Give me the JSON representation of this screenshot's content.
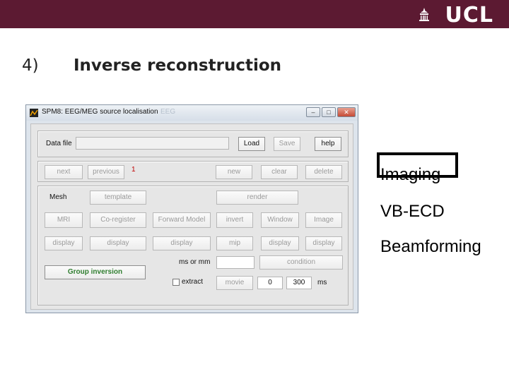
{
  "slide": {
    "logo_text": "UCL",
    "number": "4)",
    "title": "Inverse reconstruction"
  },
  "window": {
    "title": "SPM8: EEG/MEG source localisation",
    "ghost_title": "EEG",
    "buttons": {
      "minimize": "–",
      "maximize": "□",
      "close": "✕"
    }
  },
  "row1": {
    "data_file_label": "Data file",
    "data_file_value": "",
    "load": "Load",
    "save": "Save",
    "help": "help"
  },
  "row2": {
    "next": "next",
    "previous": "previous",
    "index": "1",
    "new": "new",
    "clear": "clear",
    "delete": "delete"
  },
  "row3": {
    "mesh": "Mesh",
    "template": "template",
    "render": "render"
  },
  "row4": {
    "mri": "MRI",
    "coregister": "Co-register",
    "forward_model": "Forward Model",
    "invert": "invert",
    "window": "Window",
    "image": "Image"
  },
  "row5": {
    "display": [
      "display",
      "display",
      "display",
      "mip",
      "display",
      "display"
    ]
  },
  "row6": {
    "units_label": "ms or mm",
    "units_value": "",
    "condition": "condition"
  },
  "row7": {
    "group_inversion": "Group inversion",
    "extract": "extract",
    "movie": "movie",
    "start": "0",
    "end": "300",
    "ms": "ms"
  },
  "methods": [
    "Imaging",
    "VB-ECD",
    "Beamforming"
  ],
  "colors": {
    "brand": "#5c1a32",
    "window_bg": "#dde4ec",
    "group_inversion": "#2e7d2e",
    "index": "#c00000"
  }
}
